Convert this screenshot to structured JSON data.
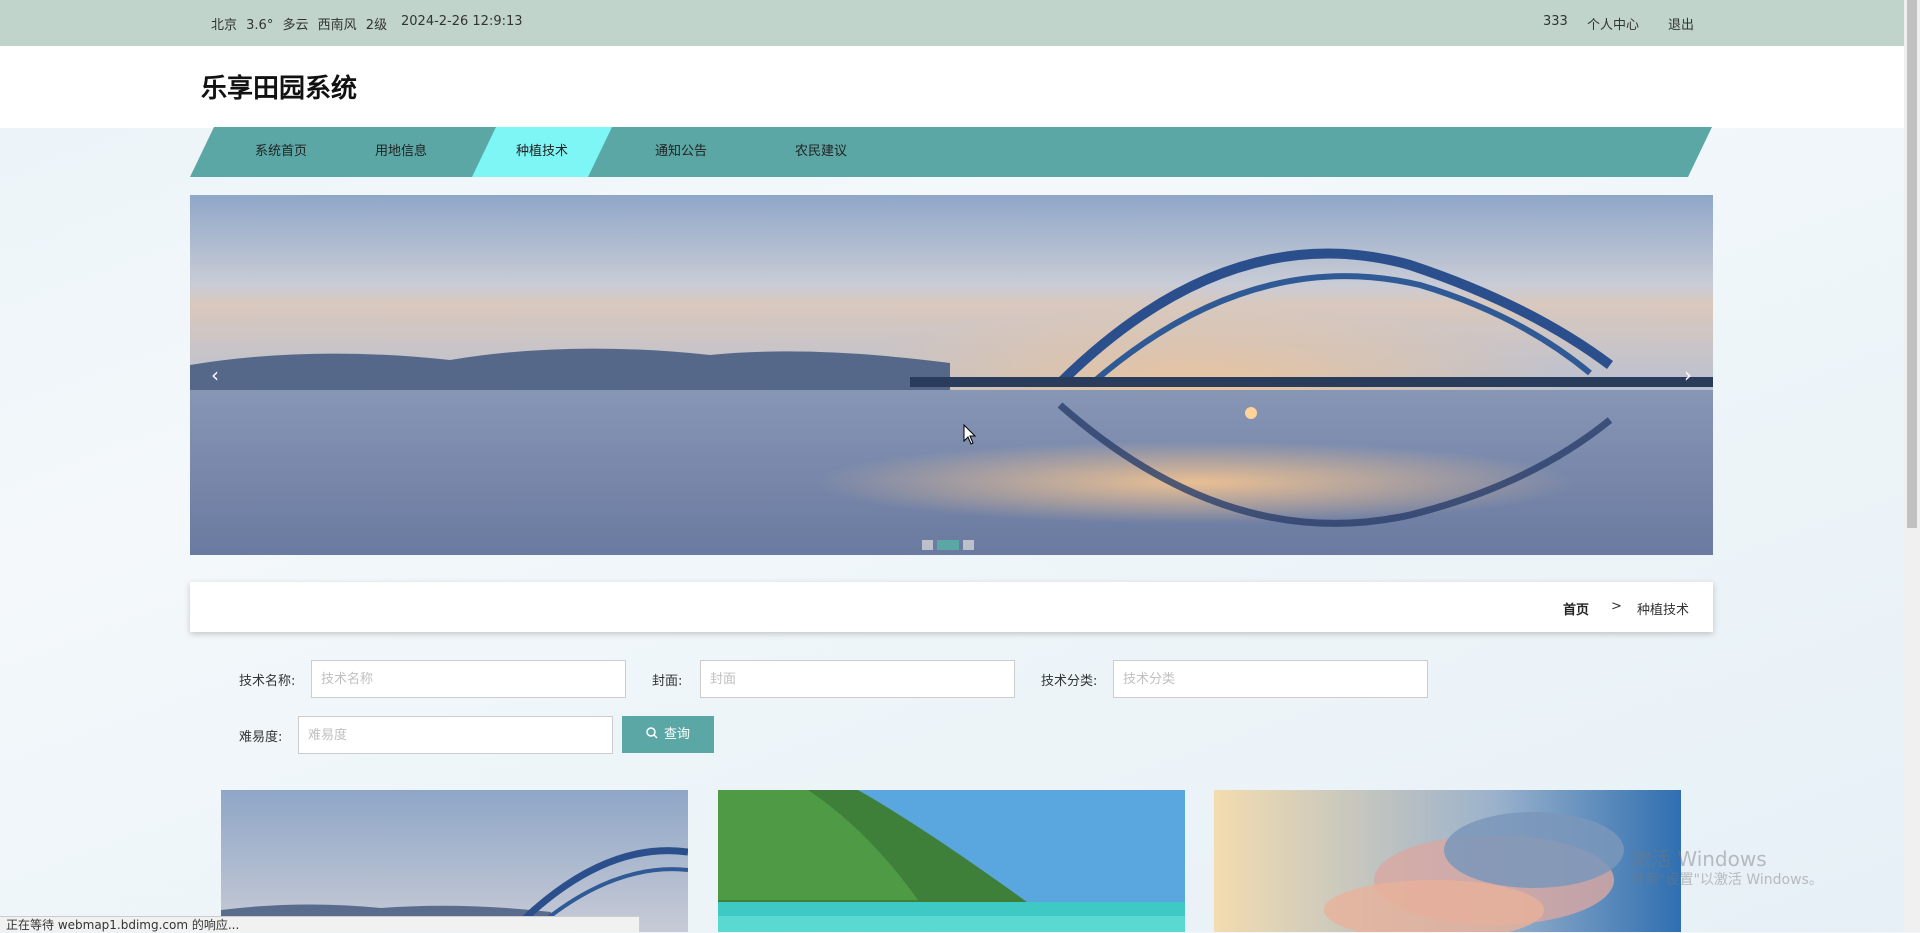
{
  "topbar": {
    "weather": [
      "北京",
      "3.6°",
      "多云",
      "西南风",
      "2级"
    ],
    "datetime": "2024-2-26 12:9:13",
    "username": "333",
    "profile_label": "个人中心",
    "logout_label": "退出"
  },
  "header": {
    "title": "乐享田园系统"
  },
  "nav": {
    "items": [
      {
        "label": "系统首页",
        "active": false
      },
      {
        "label": "用地信息",
        "active": false
      },
      {
        "label": "种植技术",
        "active": true
      },
      {
        "label": "通知公告",
        "active": false
      },
      {
        "label": "农民建议",
        "active": false
      }
    ]
  },
  "carousel": {
    "prev_icon": "chevron-left-icon",
    "next_icon": "chevron-right-icon",
    "prev_glyph": "‹",
    "next_glyph": "›",
    "slide_count": 3,
    "active_index": 1
  },
  "breadcrumb": {
    "home": "首页",
    "separator": ">",
    "current": "种植技术"
  },
  "search": {
    "fields": [
      {
        "label": "技术名称:",
        "placeholder": "技术名称",
        "value": ""
      },
      {
        "label": "封面:",
        "placeholder": "封面",
        "value": ""
      },
      {
        "label": "技术分类:",
        "placeholder": "技术分类",
        "value": ""
      },
      {
        "label": "难易度:",
        "placeholder": "难易度",
        "value": ""
      }
    ],
    "button_label": "查询",
    "button_icon": "search-icon"
  },
  "cards": [
    {
      "image": "bridge-sunset"
    },
    {
      "image": "green-island-beach"
    },
    {
      "image": "sunset-clouds"
    }
  ],
  "statusbar": {
    "text": "正在等待 webmap1.bdimg.com 的响应..."
  },
  "watermark": {
    "line1": "激活 Windows",
    "line2": "转到\"设置\"以激活 Windows。"
  },
  "colors": {
    "topbar_bg": "#c0d4cc",
    "nav_bg": "#5ba7a5",
    "nav_active_bg": "#7ef6f6",
    "button_bg": "#5ba7a5"
  }
}
